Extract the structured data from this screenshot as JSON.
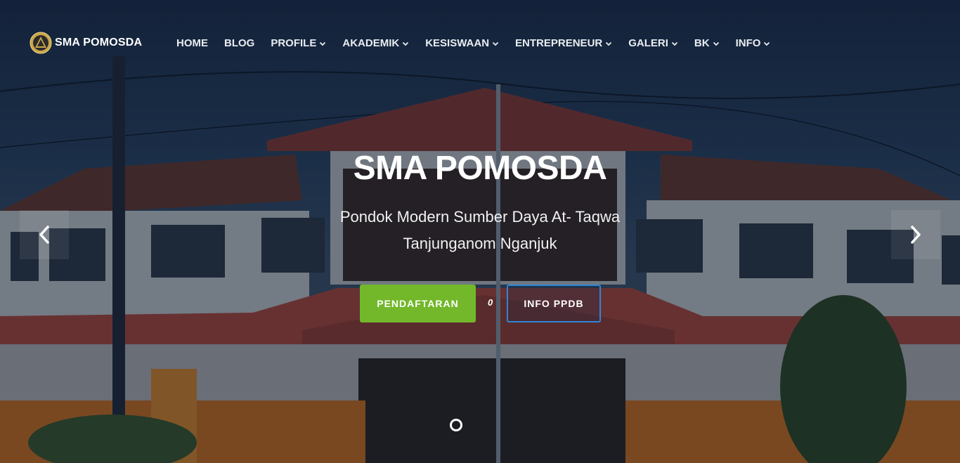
{
  "brand": {
    "name": "SMA POMOSDA",
    "logo_icon": "pomosda-emblem-icon"
  },
  "nav": {
    "items": [
      {
        "label": "HOME",
        "dropdown": false
      },
      {
        "label": "BLOG",
        "dropdown": false
      },
      {
        "label": "PROFILE",
        "dropdown": true
      },
      {
        "label": "AKADEMIK",
        "dropdown": true
      },
      {
        "label": "KESISWAAN",
        "dropdown": true
      },
      {
        "label": "ENTREPRENEUR",
        "dropdown": true
      },
      {
        "label": "GALERI",
        "dropdown": true
      },
      {
        "label": "BK",
        "dropdown": true
      },
      {
        "label": "INFO",
        "dropdown": true
      }
    ]
  },
  "hero": {
    "title": "SMA POMOSDA",
    "subtitle_line1": "Pondok Modern Sumber Daya At- Taqwa",
    "subtitle_line2": "Tanjunganom Nganjuk",
    "buttons": {
      "primary": "PENDAFTARAN",
      "separator": "0",
      "secondary": "INFO PPDB"
    }
  },
  "carousel": {
    "prev_icon": "chevron-left-icon",
    "next_icon": "chevron-right-icon",
    "active_slide": 1
  },
  "colors": {
    "primary_button": "#72b82a",
    "secondary_border": "#2f86d6"
  }
}
